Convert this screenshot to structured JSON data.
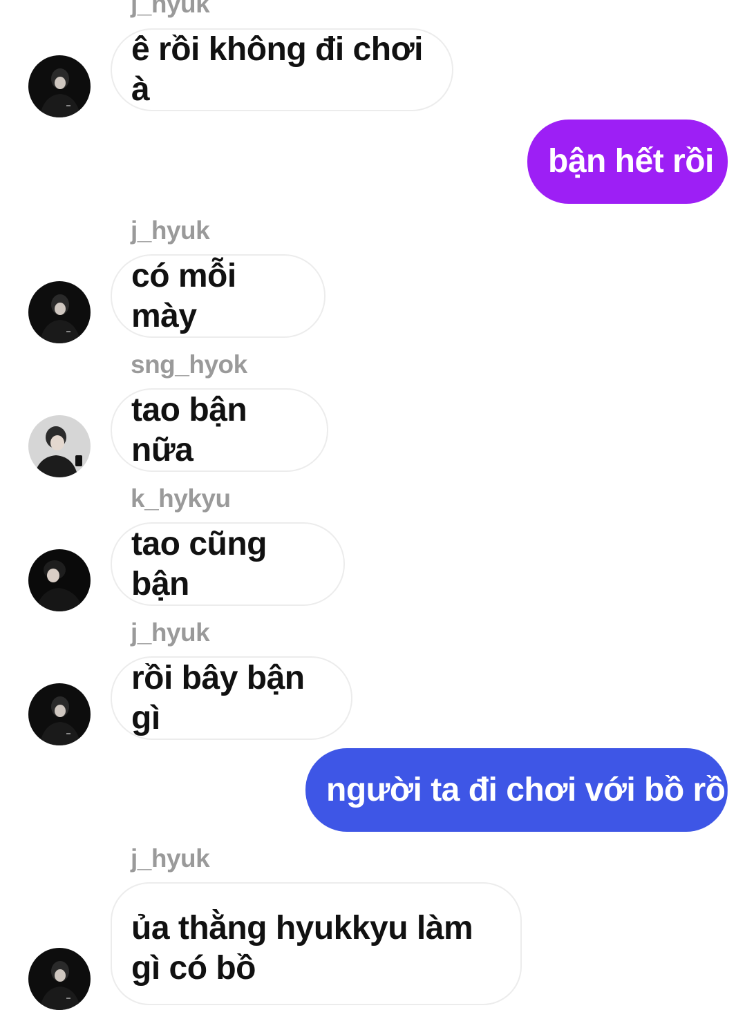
{
  "colors": {
    "outgoing_1": "#9d1ff5",
    "outgoing_2": "#3e56e6",
    "sender_name": "#9a9a9a",
    "incoming_border": "#ececec"
  },
  "messages": [
    {
      "sender": "j_hyuk",
      "text": "ê rồi không đi chơi à",
      "avatar": "avatar-j_hyuk-icon"
    },
    {
      "sender": "me",
      "text": "bận hết rồi"
    },
    {
      "sender": "j_hyuk",
      "text": "có mỗi mày",
      "avatar": "avatar-j_hyuk-icon"
    },
    {
      "sender": "sng_hyok",
      "text": "tao bận nữa",
      "avatar": "avatar-sng_hyok-icon"
    },
    {
      "sender": "k_hykyu",
      "text": "tao cũng bận",
      "avatar": "avatar-k_hykyu-icon"
    },
    {
      "sender": "j_hyuk",
      "text": "rồi bây bận gì",
      "avatar": "avatar-j_hyuk-icon"
    },
    {
      "sender": "me",
      "text": "người ta đi chơi với bồ rồi"
    },
    {
      "sender": "j_hyuk",
      "text": "ủa thằng hyukkyu làm gì có bồ",
      "avatar": "avatar-j_hyuk-icon"
    }
  ]
}
